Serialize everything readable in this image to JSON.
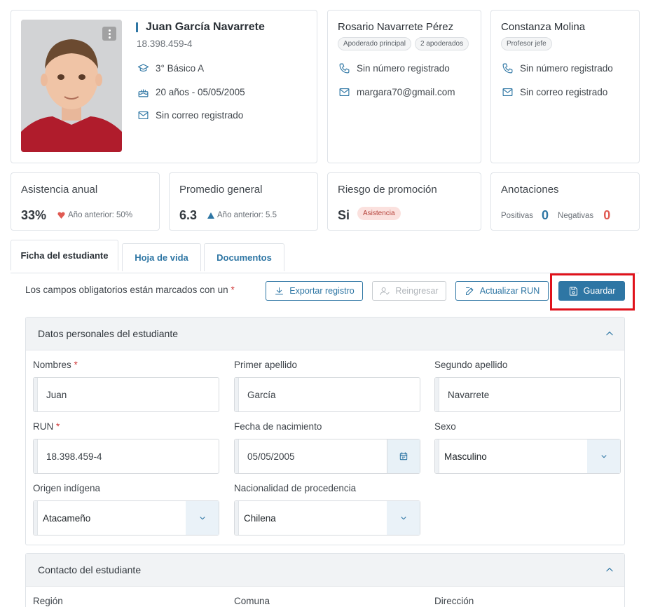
{
  "student": {
    "name": "Juan García Navarrete",
    "run": "18.398.459-4",
    "course": "3° Básico A",
    "age_birth": "20 años - 05/05/2005",
    "email": "Sin correo registrado"
  },
  "guardian": {
    "name": "Rosario Navarrete Pérez",
    "badges": [
      "Apoderado principal",
      "2 apoderados"
    ],
    "phone": "Sin número registrado",
    "email": "margara70@gmail.com"
  },
  "teacher": {
    "name": "Constanza Molina",
    "badge": "Profesor jefe",
    "phone": "Sin número registrado",
    "email": "Sin correo registrado"
  },
  "stats": {
    "attendance": {
      "title": "Asistencia anual",
      "value": "33%",
      "prev": "Año anterior: 50%"
    },
    "average": {
      "title": "Promedio general",
      "value": "6.3",
      "prev": "Año anterior: 5.5"
    },
    "risk": {
      "title": "Riesgo de promoción",
      "value": "Si",
      "badge": "Asistencia"
    },
    "notes": {
      "title": "Anotaciones",
      "positive_label": "Positivas",
      "positive": "0",
      "negative_label": "Negativas",
      "negative": "0"
    }
  },
  "tabs": [
    "Ficha del estudiante",
    "Hoja de vida",
    "Documentos"
  ],
  "toolbar": {
    "required_note": "Los campos obligatorios están marcados con un",
    "required_mark": "*",
    "export_label": "Exportar registro",
    "reenroll_label": "Reingresar",
    "update_run_label": "Actualizar RUN",
    "save_label": "Guardar"
  },
  "personal": {
    "title": "Datos personales del estudiante",
    "first_name_label": "Nombres",
    "first_name": "Juan",
    "last1_label": "Primer apellido",
    "last1": "García",
    "last2_label": "Segundo apellido",
    "last2": "Navarrete",
    "run_label": "RUN",
    "run": "18.398.459-4",
    "birth_label": "Fecha de nacimiento",
    "birth": "05/05/2005",
    "sex_label": "Sexo",
    "sex": "Masculino",
    "indigenous_label": "Origen indígena",
    "indigenous": "Atacameño",
    "nationality_label": "Nacionalidad de procedencia",
    "nationality": "Chilena"
  },
  "contact": {
    "title": "Contacto del estudiante",
    "region_label": "Región",
    "commune_label": "Comuna",
    "address_label": "Dirección"
  },
  "colors": {
    "accent": "#2e76a4",
    "danger": "#e0121b",
    "negative": "#e05a52"
  }
}
